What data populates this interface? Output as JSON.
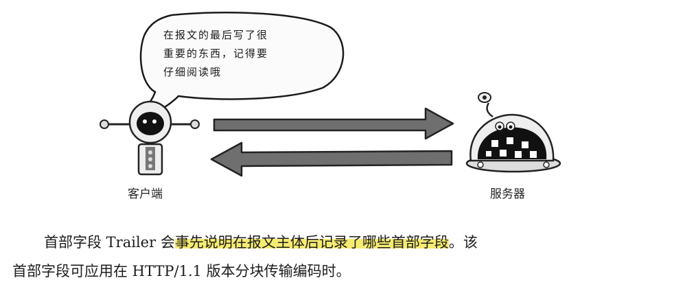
{
  "speech_bubble": {
    "lines": [
      "在报文的最后写了很",
      "重要的东西，记得要",
      "仔细阅读哦"
    ]
  },
  "labels": {
    "client": "客户端",
    "server": "服务器"
  },
  "paragraph": {
    "line1_before": "首部字段 Trailer 会",
    "line1_highlight": "事先说明在报文主体后记录了哪些首部字段",
    "line1_after": "。该",
    "line2": "首部字段可应用在 HTTP/1.1 版本分块传输编码时。"
  },
  "colors": {
    "highlight": "#f6eb72",
    "arrow": "#6f6f6f"
  },
  "icons": {
    "client": "robot-icon",
    "server": "dome-robot-icon"
  }
}
